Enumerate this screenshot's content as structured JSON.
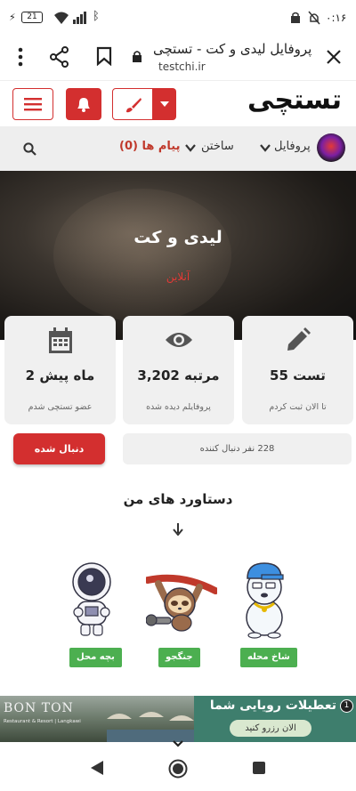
{
  "status_bar": {
    "time": "۰:۱۶",
    "battery": "21"
  },
  "browser": {
    "page_title": "پروفایل لیدی و کت - تستچی",
    "url": "testchi.ir"
  },
  "site": {
    "logo": "تستچی"
  },
  "nav": {
    "profile": "پروفایل",
    "build": "ساختن",
    "messages": "پیام ها (0)"
  },
  "profile": {
    "name": "لیدی و کت",
    "status": "آنلاین"
  },
  "stats": [
    {
      "value": "55 تست",
      "caption": "تا الان ثبت کردم",
      "icon": "pencil-icon"
    },
    {
      "value": "3,202 مرتبه",
      "caption": "پروفایلم دیده شده",
      "icon": "eye-icon"
    },
    {
      "value": "2 ماه پیش",
      "caption": "عضو تستچی شدم",
      "icon": "calendar-icon"
    }
  ],
  "followers": {
    "text": "228 نفر دنبال کننده",
    "button": "دنبال شده"
  },
  "achievements": {
    "title": "دستاورد های من",
    "items": [
      {
        "label": "شاخ محله",
        "icon": "polar-bear-icon"
      },
      {
        "label": "جنگجو",
        "icon": "sloth-icon"
      },
      {
        "label": "بچه محل",
        "icon": "astronaut-icon"
      }
    ]
  },
  "ad": {
    "brand": "BON TON",
    "brand_sub": "Restaurant & Resort | Langkawi",
    "headline": "تعطیلات رویایی شما",
    "cta": "الان رزرو کنید"
  },
  "colors": {
    "accent": "#d32f2f",
    "badge": "#4caf50",
    "card": "#f0f0f0"
  }
}
